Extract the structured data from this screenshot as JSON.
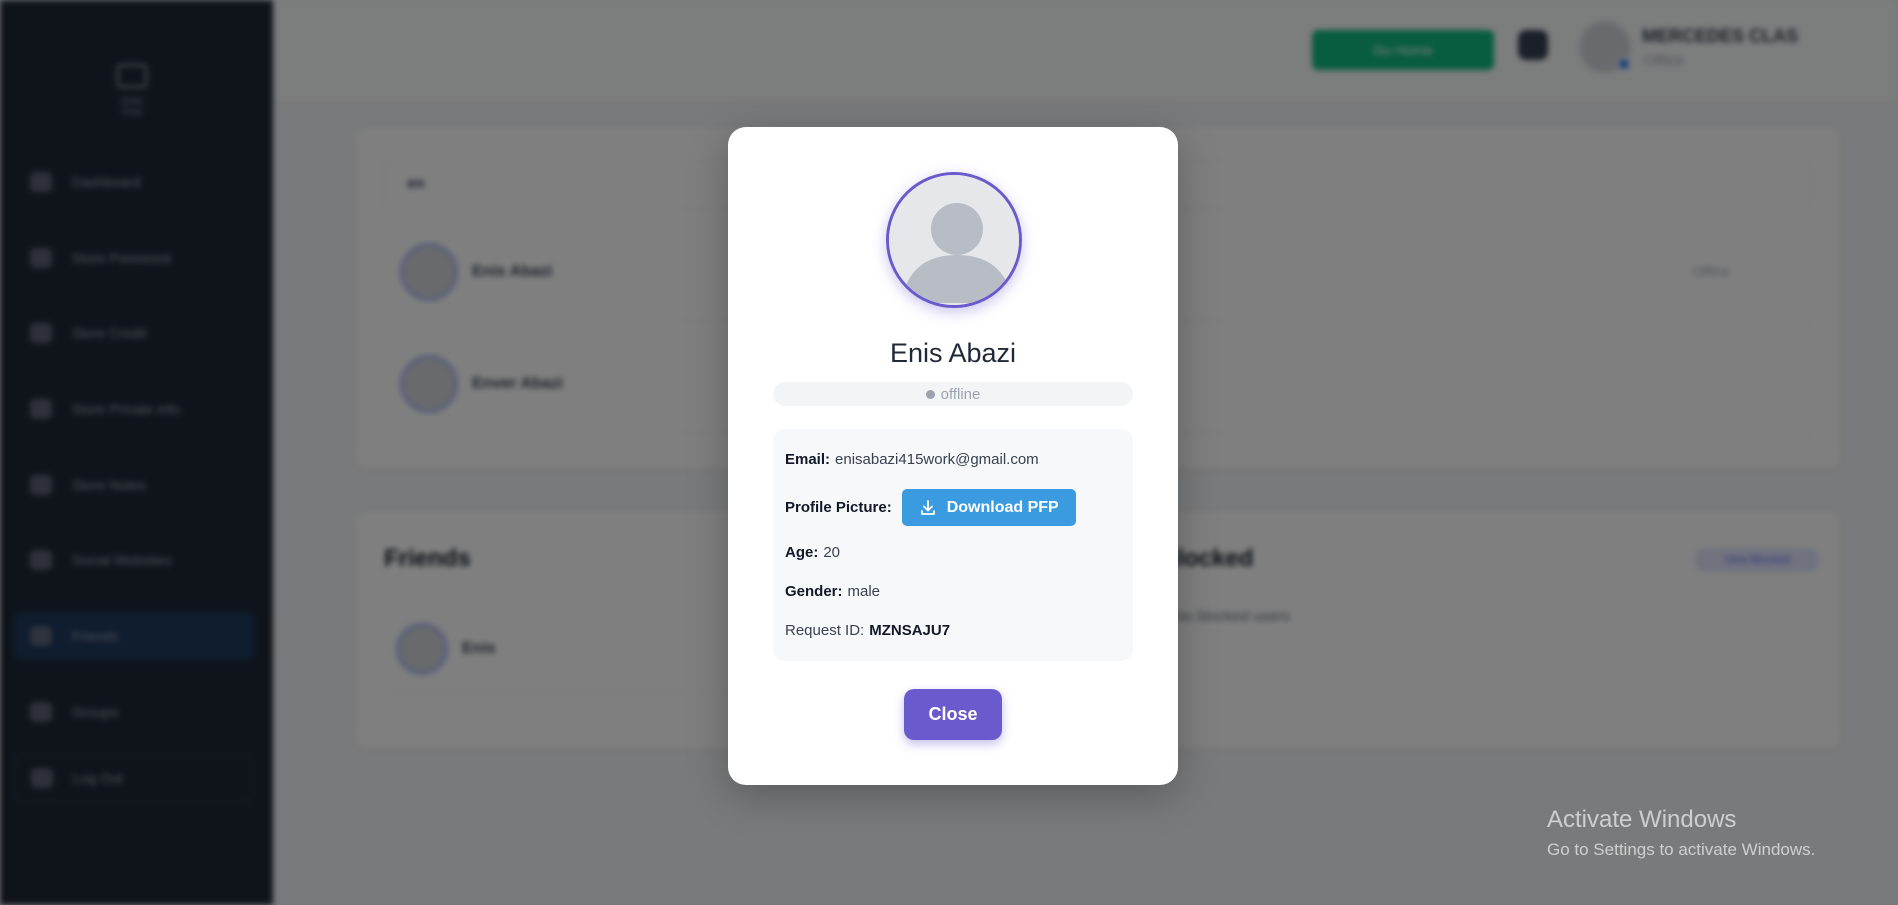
{
  "background": {
    "sidebar": {
      "logo_label": "Activ Find",
      "items": [
        {
          "label": "Dashboard",
          "icon": "home-icon"
        },
        {
          "label": "Store Password",
          "icon": "lock-icon"
        },
        {
          "label": "Store Credit",
          "icon": "card-icon"
        },
        {
          "label": "Store Private Info",
          "icon": "globe-icon"
        },
        {
          "label": "Store Notes",
          "icon": "note-icon"
        },
        {
          "label": "Social Websites",
          "icon": "chat-icon"
        },
        {
          "label": "Friends",
          "icon": "users-icon",
          "active": true
        },
        {
          "label": "Groups",
          "icon": "group-icon"
        }
      ],
      "logout_label": "Log Out"
    },
    "topbar": {
      "go_home_label": "Go Home",
      "user_name": "MERCEDES CLAS",
      "user_status": "Offline"
    },
    "search": {
      "value": "en"
    },
    "results": [
      {
        "name": "Enis Abazi",
        "extra": "Offline"
      },
      {
        "name": "Enver Abazi",
        "extra": ""
      }
    ],
    "friends_title": "Friends",
    "blocked_title": "Blocked",
    "blocked_text": "No blocked users",
    "blocked_pill": "View Blocked",
    "friend_rows": [
      {
        "name": "Enis"
      }
    ]
  },
  "watermark": {
    "title": "Activate Windows",
    "subtitle": "Go to Settings to activate Windows."
  },
  "modal": {
    "name": "Enis Abazi",
    "status": "offline",
    "email_label": "Email:",
    "email": "enisabazi415work@gmail.com",
    "pfp_label": "Profile Picture:",
    "download_label": "Download PFP",
    "age_label": "Age:",
    "age": "20",
    "gender_label": "Gender:",
    "gender": "male",
    "request_label": "Request ID:",
    "request_id": "MZNSAJU7",
    "close_label": "Close"
  },
  "colors": {
    "accent": "#6a5acd",
    "download_button": "#3b9be0",
    "go_home": "#10b981",
    "sidebar_bg": "#1f2937"
  }
}
